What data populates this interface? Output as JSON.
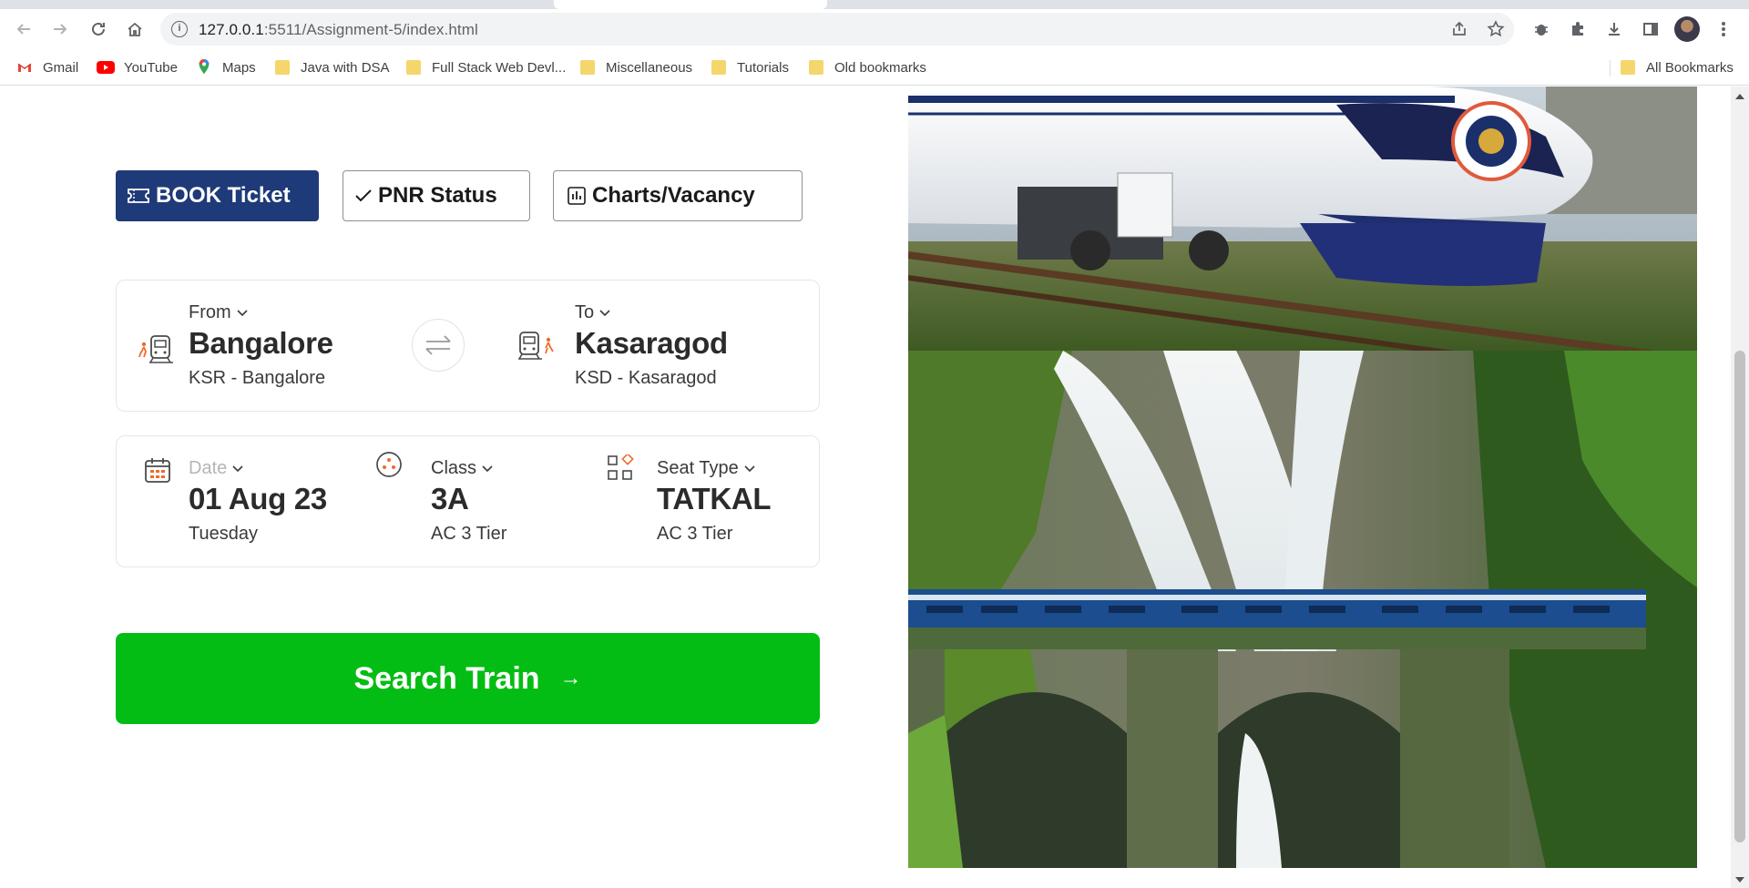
{
  "browser": {
    "url_host": "127.0.0.1",
    "url_rest": ":5511/Assignment-5/index.html",
    "bookmarks": [
      {
        "label": "Gmail",
        "icon": "gmail-icon"
      },
      {
        "label": "YouTube",
        "icon": "youtube-icon"
      },
      {
        "label": "Maps",
        "icon": "maps-icon"
      },
      {
        "label": "Java with DSA",
        "icon": "folder-icon"
      },
      {
        "label": "Full Stack Web Devl...",
        "icon": "folder-icon"
      },
      {
        "label": "Miscellaneous",
        "icon": "folder-icon"
      },
      {
        "label": "Tutorials",
        "icon": "folder-icon"
      },
      {
        "label": "Old bookmarks",
        "icon": "folder-icon"
      }
    ],
    "all_bookmarks": "All Bookmarks"
  },
  "tabs": {
    "book": "BOOK Ticket",
    "pnr": "PNR Status",
    "charts": "Charts/Vacancy"
  },
  "route": {
    "from_label": "From",
    "from_city": "Bangalore",
    "from_station": "KSR - Bangalore",
    "to_label": "To",
    "to_city": "Kasaragod",
    "to_station": "KSD - Kasaragod"
  },
  "options": {
    "date_label": "Date",
    "date_value": "01 Aug 23",
    "date_day": "Tuesday",
    "class_label": "Class",
    "class_value": "3A",
    "class_desc": "AC 3 Tier",
    "seat_label": "Seat Type",
    "seat_value": "TATKAL",
    "seat_desc": "AC 3 Tier"
  },
  "search": {
    "label": "Search Train",
    "arrow": "→"
  },
  "colors": {
    "primary_tab": "#1f3a78",
    "search_button": "#04bd14",
    "accent_orange": "#f06a2b"
  }
}
